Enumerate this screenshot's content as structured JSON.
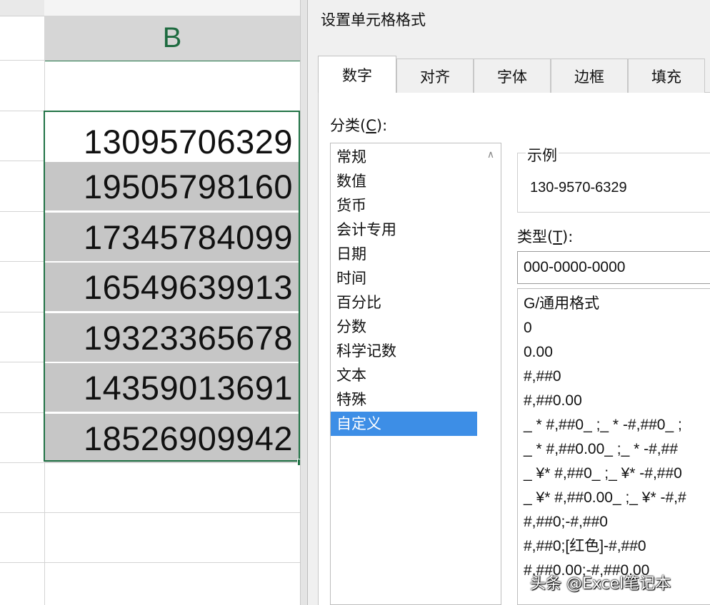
{
  "sheet": {
    "column_label": "B",
    "cells": [
      "13095706329",
      "19505798160",
      "17345784099",
      "16549639913",
      "19323365678",
      "14359013691",
      "18526909942"
    ]
  },
  "dialog": {
    "title": "设置单元格格式",
    "tabs": [
      "数字",
      "对齐",
      "字体",
      "边框",
      "填充"
    ],
    "active_tab": "数字",
    "category_label": "分类",
    "category_hotkey": "C",
    "categories": [
      "常规",
      "数值",
      "货币",
      "会计专用",
      "日期",
      "时间",
      "百分比",
      "分数",
      "科学记数",
      "文本",
      "特殊",
      "自定义"
    ],
    "selected_category": "自定义",
    "sample_label": "示例",
    "sample_value": "130-9570-6329",
    "type_label": "类型",
    "type_hotkey": "T",
    "type_value": "000-0000-0000",
    "formats": [
      "G/通用格式",
      "0",
      "0.00",
      "#,##0",
      "#,##0.00",
      "_ * #,##0_ ;_ * -#,##0_ ;",
      "_ * #,##0.00_ ;_ * -#,##",
      "_ ¥* #,##0_ ;_ ¥* -#,##0",
      "_ ¥* #,##0.00_ ;_ ¥* -#,#",
      "#,##0;-#,##0",
      "#,##0;[红色]-#,##0",
      "#,##0.00;-#,##0.00"
    ]
  },
  "watermark": "头条 @Excel笔记本",
  "colors": {
    "accent_green": "#217346",
    "selection_blue": "#3d8ee6",
    "selected_cell_gray": "#c6c6c6"
  }
}
